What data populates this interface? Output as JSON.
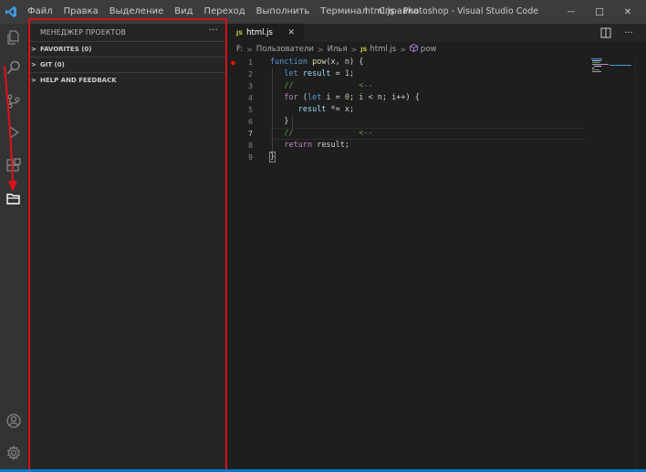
{
  "titlebar": {
    "menu": [
      "Файл",
      "Правка",
      "Выделение",
      "Вид",
      "Переход",
      "Выполнить",
      "Терминал",
      "Справка"
    ],
    "window_title": "html.js - Photoshop - Visual Studio Code",
    "controls": {
      "minimize": "—",
      "maximize": "☐",
      "close": "✕"
    }
  },
  "activitybar": {
    "icons": [
      "explorer-icon",
      "search-icon",
      "source-control-icon",
      "run-debug-icon",
      "extensions-icon",
      "project-manager-icon"
    ],
    "bottom_icons": [
      "account-icon",
      "settings-gear-icon"
    ]
  },
  "sidebar": {
    "title": "МЕНЕДЖЕР ПРОЕКТОВ",
    "more": "···",
    "sections": [
      {
        "label": "FAVORITES (0)",
        "chevron": ">"
      },
      {
        "label": "GIT (0)",
        "chevron": ">"
      },
      {
        "label": "HELP AND FEEDBACK",
        "chevron": ">"
      }
    ]
  },
  "editor": {
    "tab": {
      "badge": "JS",
      "label": "html.js",
      "close": "✕"
    },
    "breadcrumb": {
      "drive": "F:",
      "folder1": "Пользователи",
      "folder2": "Илья",
      "file_badge": "JS",
      "file": "html.js",
      "symbol": "pow",
      "sep": ">"
    },
    "lines": [
      {
        "n": "1"
      },
      {
        "n": "2"
      },
      {
        "n": "3"
      },
      {
        "n": "4"
      },
      {
        "n": "5"
      },
      {
        "n": "6"
      },
      {
        "n": "7"
      },
      {
        "n": "8"
      },
      {
        "n": "9"
      }
    ],
    "code": {
      "l1_kw": "function",
      "l1_fn": "pow",
      "l1_rest": "(x, n) {",
      "l2_kw": "let",
      "l2_var": "result",
      "l2_eq": " = ",
      "l2_num": "1",
      "l2_end": ";",
      "l3": "//              <--",
      "l4_kw": "for",
      "l4_a": " (",
      "l4_kw2": "let",
      "l4_b": " i = ",
      "l4_num": "0",
      "l4_c": "; i < n; i++) {",
      "l5_var": "result",
      "l5_rest": " *= x;",
      "l6": "}",
      "l7": "//              <--",
      "l8_kw": "return",
      "l8_rest": " result;",
      "l9": "}"
    }
  },
  "colors": {
    "accent": "#007acc",
    "highlight_frame": "#d4111b",
    "arrow": "#e0101a"
  }
}
